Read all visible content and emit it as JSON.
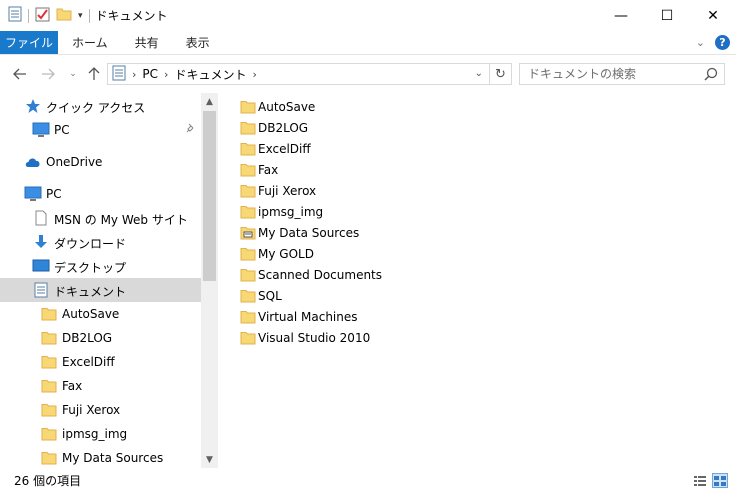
{
  "window": {
    "title": "ドキュメント",
    "minimize_glyph": "—",
    "maximize_glyph": "☐",
    "close_glyph": "✕"
  },
  "ribbon": {
    "tabs": [
      "ファイル",
      "ホーム",
      "共有",
      "表示"
    ]
  },
  "address": {
    "crumbs": [
      "PC",
      "ドキュメント"
    ]
  },
  "search": {
    "placeholder": "ドキュメントの検索"
  },
  "nav_pane": {
    "items": [
      {
        "label": "クイック アクセス",
        "icon": "star-icon",
        "level": 0
      },
      {
        "label": "PC",
        "icon": "pc-icon",
        "level": 1,
        "pinned": true
      },
      {
        "label": "OneDrive",
        "icon": "cloud-icon",
        "level": 0
      },
      {
        "label": "PC",
        "icon": "pc-icon",
        "level": 0
      },
      {
        "label": "MSN の My Web サイト",
        "icon": "document-icon",
        "level": 1
      },
      {
        "label": "ダウンロード",
        "icon": "download-icon",
        "level": 1
      },
      {
        "label": "デスクトップ",
        "icon": "desktop-icon",
        "level": 1
      },
      {
        "label": "ドキュメント",
        "icon": "documents-icon",
        "level": 1,
        "selected": true
      },
      {
        "label": "AutoSave",
        "icon": "folder-icon",
        "level": 2
      },
      {
        "label": "DB2LOG",
        "icon": "folder-icon",
        "level": 2
      },
      {
        "label": "ExcelDiff",
        "icon": "folder-icon",
        "level": 2
      },
      {
        "label": "Fax",
        "icon": "folder-icon",
        "level": 2
      },
      {
        "label": "Fuji Xerox",
        "icon": "folder-icon",
        "level": 2
      },
      {
        "label": "ipmsg_img",
        "icon": "folder-icon",
        "level": 2
      },
      {
        "label": "My Data Sources",
        "icon": "folder-icon",
        "level": 2
      }
    ]
  },
  "content": {
    "items": [
      {
        "label": "AutoSave",
        "icon": "folder-icon"
      },
      {
        "label": "DB2LOG",
        "icon": "folder-icon"
      },
      {
        "label": "ExcelDiff",
        "icon": "folder-icon"
      },
      {
        "label": "Fax",
        "icon": "folder-icon"
      },
      {
        "label": "Fuji Xerox",
        "icon": "folder-icon"
      },
      {
        "label": "ipmsg_img",
        "icon": "folder-icon"
      },
      {
        "label": "My Data Sources",
        "icon": "data-sources-folder-icon"
      },
      {
        "label": "My GOLD",
        "icon": "folder-icon"
      },
      {
        "label": "Scanned Documents",
        "icon": "folder-icon"
      },
      {
        "label": "SQL",
        "icon": "folder-icon"
      },
      {
        "label": "Virtual Machines",
        "icon": "folder-icon"
      },
      {
        "label": "Visual Studio 2010",
        "icon": "folder-icon"
      }
    ]
  },
  "status": {
    "item_count": "26 個の項目"
  },
  "colors": {
    "accent": "#1979ca",
    "folder": "#f8d775",
    "folder_dark": "#e0b34a",
    "selection": "#d9d9d9"
  }
}
